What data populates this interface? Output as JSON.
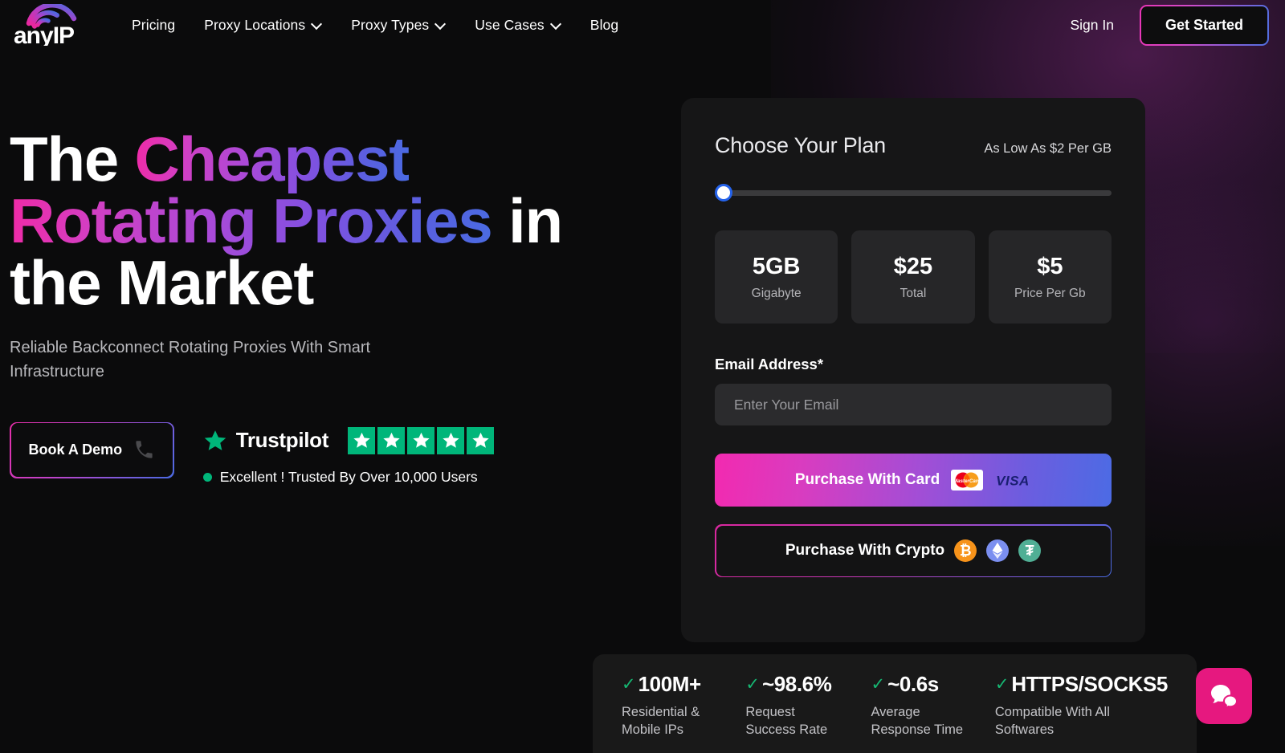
{
  "brand": {
    "name": "anyIP",
    "logo_icon": "anyip-cloud-wifi-logo",
    "gradient_start": "#f02aa6",
    "gradient_end": "#4a6be2"
  },
  "nav": {
    "links": [
      {
        "label": "Pricing",
        "has_dropdown": false
      },
      {
        "label": "Proxy Locations",
        "has_dropdown": true
      },
      {
        "label": "Proxy Types",
        "has_dropdown": true
      },
      {
        "label": "Use Cases",
        "has_dropdown": true
      },
      {
        "label": "Blog",
        "has_dropdown": false
      }
    ],
    "sign_in": "Sign In",
    "get_started": "Get Started"
  },
  "hero": {
    "headline_part1": "The ",
    "headline_grad1": "Cheapest",
    "headline_grad2": "Rotating Proxies",
    "headline_part2": " in",
    "headline_part3": "the Market",
    "subhead": "Reliable Backconnect Rotating Proxies With Smart Infrastructure",
    "demo_button": "Book A Demo",
    "demo_icon": "phone-icon",
    "trustpilot": {
      "name": "Trustpilot",
      "star_icon": "star-icon",
      "star_count": 5,
      "star_color": "#00b67a",
      "rating_text": "Excellent ! Trusted By Over 10,000 Users"
    }
  },
  "plan": {
    "title": "Choose Your Plan",
    "note": "As Low As $2 Per GB",
    "slider": {
      "value": 0,
      "min": 0,
      "max": 100
    },
    "boxes": [
      {
        "value": "5GB",
        "label": "Gigabyte"
      },
      {
        "value": "$25",
        "label": "Total"
      },
      {
        "value": "$5",
        "label": "Price Per Gb"
      }
    ],
    "email_label": "Email Address*",
    "email_value": "",
    "email_placeholder": "Enter Your Email",
    "pay_card_label": "Purchase With Card",
    "card_brands": [
      "mastercard-icon",
      "visa-icon"
    ],
    "pay_crypto_label": "Purchase With Crypto",
    "crypto_coins": [
      {
        "name": "bitcoin-icon",
        "glyph": "₿",
        "color": "#f7931a"
      },
      {
        "name": "ethereum-icon",
        "glyph": "◆",
        "color": "#7b8ff0"
      },
      {
        "name": "tether-icon",
        "glyph": "₮",
        "color": "#50af95"
      }
    ]
  },
  "stats": [
    {
      "value": "100M+",
      "desc": "Residential &\nMobile IPs"
    },
    {
      "value": "~98.6%",
      "desc": "Request\nSuccess Rate"
    },
    {
      "value": "~0.6s",
      "desc": "Average\nResponse Time"
    },
    {
      "value": "HTTPS/SOCKS5",
      "desc": "Compatible With All\nSoftwares"
    }
  ],
  "chat": {
    "icon": "chat-bubbles-icon",
    "color": "#e6187f"
  }
}
